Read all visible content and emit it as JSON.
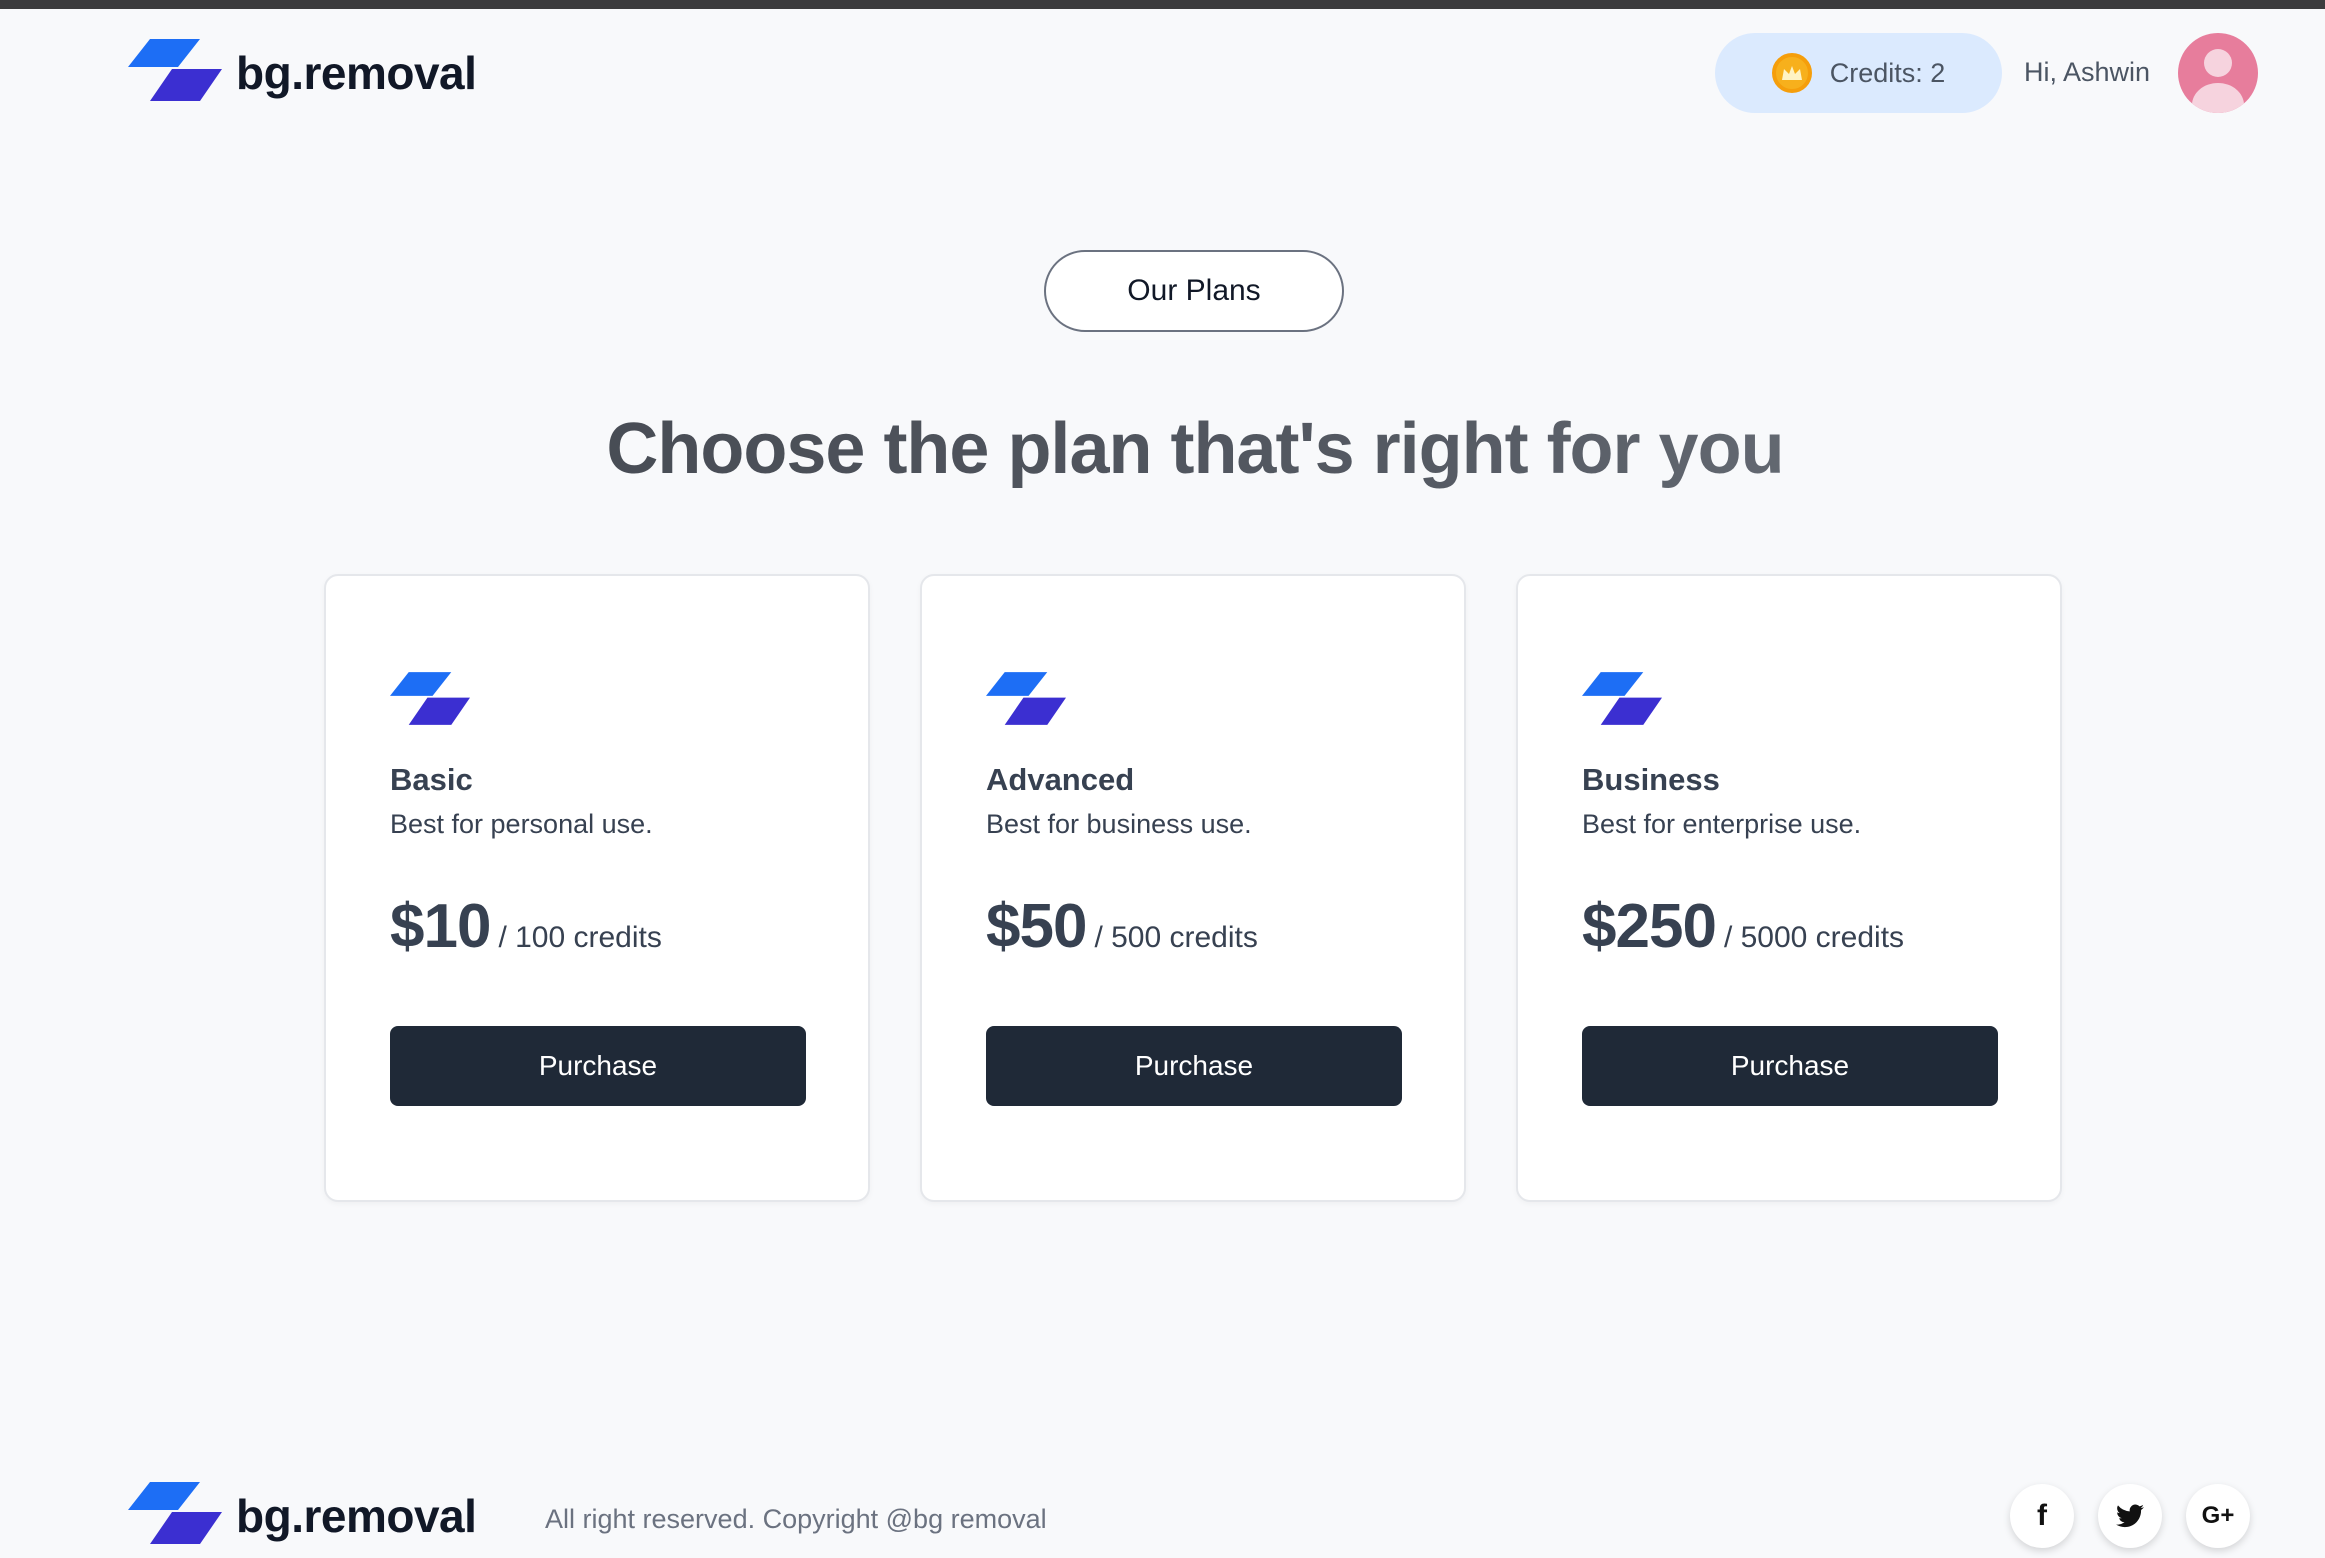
{
  "header": {
    "brand": "bg.removal",
    "credits_label": "Credits: 2",
    "greeting": "Hi, Ashwin"
  },
  "section": {
    "badge": "Our Plans",
    "headline": "Choose the plan that's right for you"
  },
  "plans": [
    {
      "name": "Basic",
      "description": "Best for personal use.",
      "price": "$10",
      "per": "/ 100 credits",
      "button": "Purchase"
    },
    {
      "name": "Advanced",
      "description": "Best for business use.",
      "price": "$50",
      "per": "/ 500 credits",
      "button": "Purchase"
    },
    {
      "name": "Business",
      "description": "Best for enterprise use.",
      "price": "$250",
      "per": "/ 5000 credits",
      "button": "Purchase"
    }
  ],
  "footer": {
    "brand": "bg.removal",
    "copyright": "All right reserved. Copyright @bg removal",
    "social": [
      {
        "icon": "facebook-icon",
        "glyph": "f"
      },
      {
        "icon": "twitter-icon",
        "glyph": "🐦"
      },
      {
        "icon": "google-plus-icon",
        "glyph": "G+"
      }
    ]
  },
  "colors": {
    "accent_blue": "#1d6ef5",
    "accent_indigo": "#3b2fd1",
    "button_dark": "#1f2937",
    "credits_bg": "#dbeafe"
  }
}
